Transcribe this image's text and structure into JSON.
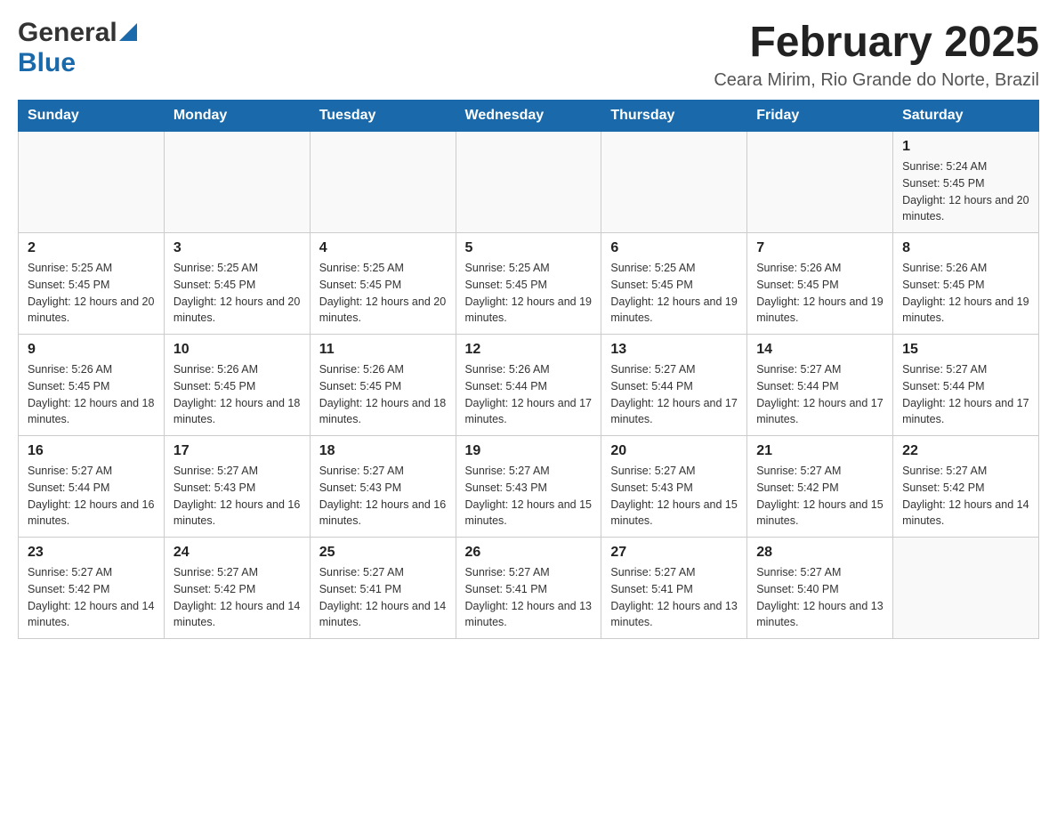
{
  "header": {
    "logo_general": "General",
    "logo_blue": "Blue",
    "title": "February 2025",
    "subtitle": "Ceara Mirim, Rio Grande do Norte, Brazil"
  },
  "days_of_week": [
    "Sunday",
    "Monday",
    "Tuesday",
    "Wednesday",
    "Thursday",
    "Friday",
    "Saturday"
  ],
  "weeks": [
    {
      "days": [
        {
          "number": "",
          "info": ""
        },
        {
          "number": "",
          "info": ""
        },
        {
          "number": "",
          "info": ""
        },
        {
          "number": "",
          "info": ""
        },
        {
          "number": "",
          "info": ""
        },
        {
          "number": "",
          "info": ""
        },
        {
          "number": "1",
          "info": "Sunrise: 5:24 AM\nSunset: 5:45 PM\nDaylight: 12 hours and 20 minutes."
        }
      ]
    },
    {
      "days": [
        {
          "number": "2",
          "info": "Sunrise: 5:25 AM\nSunset: 5:45 PM\nDaylight: 12 hours and 20 minutes."
        },
        {
          "number": "3",
          "info": "Sunrise: 5:25 AM\nSunset: 5:45 PM\nDaylight: 12 hours and 20 minutes."
        },
        {
          "number": "4",
          "info": "Sunrise: 5:25 AM\nSunset: 5:45 PM\nDaylight: 12 hours and 20 minutes."
        },
        {
          "number": "5",
          "info": "Sunrise: 5:25 AM\nSunset: 5:45 PM\nDaylight: 12 hours and 19 minutes."
        },
        {
          "number": "6",
          "info": "Sunrise: 5:25 AM\nSunset: 5:45 PM\nDaylight: 12 hours and 19 minutes."
        },
        {
          "number": "7",
          "info": "Sunrise: 5:26 AM\nSunset: 5:45 PM\nDaylight: 12 hours and 19 minutes."
        },
        {
          "number": "8",
          "info": "Sunrise: 5:26 AM\nSunset: 5:45 PM\nDaylight: 12 hours and 19 minutes."
        }
      ]
    },
    {
      "days": [
        {
          "number": "9",
          "info": "Sunrise: 5:26 AM\nSunset: 5:45 PM\nDaylight: 12 hours and 18 minutes."
        },
        {
          "number": "10",
          "info": "Sunrise: 5:26 AM\nSunset: 5:45 PM\nDaylight: 12 hours and 18 minutes."
        },
        {
          "number": "11",
          "info": "Sunrise: 5:26 AM\nSunset: 5:45 PM\nDaylight: 12 hours and 18 minutes."
        },
        {
          "number": "12",
          "info": "Sunrise: 5:26 AM\nSunset: 5:44 PM\nDaylight: 12 hours and 17 minutes."
        },
        {
          "number": "13",
          "info": "Sunrise: 5:27 AM\nSunset: 5:44 PM\nDaylight: 12 hours and 17 minutes."
        },
        {
          "number": "14",
          "info": "Sunrise: 5:27 AM\nSunset: 5:44 PM\nDaylight: 12 hours and 17 minutes."
        },
        {
          "number": "15",
          "info": "Sunrise: 5:27 AM\nSunset: 5:44 PM\nDaylight: 12 hours and 17 minutes."
        }
      ]
    },
    {
      "days": [
        {
          "number": "16",
          "info": "Sunrise: 5:27 AM\nSunset: 5:44 PM\nDaylight: 12 hours and 16 minutes."
        },
        {
          "number": "17",
          "info": "Sunrise: 5:27 AM\nSunset: 5:43 PM\nDaylight: 12 hours and 16 minutes."
        },
        {
          "number": "18",
          "info": "Sunrise: 5:27 AM\nSunset: 5:43 PM\nDaylight: 12 hours and 16 minutes."
        },
        {
          "number": "19",
          "info": "Sunrise: 5:27 AM\nSunset: 5:43 PM\nDaylight: 12 hours and 15 minutes."
        },
        {
          "number": "20",
          "info": "Sunrise: 5:27 AM\nSunset: 5:43 PM\nDaylight: 12 hours and 15 minutes."
        },
        {
          "number": "21",
          "info": "Sunrise: 5:27 AM\nSunset: 5:42 PM\nDaylight: 12 hours and 15 minutes."
        },
        {
          "number": "22",
          "info": "Sunrise: 5:27 AM\nSunset: 5:42 PM\nDaylight: 12 hours and 14 minutes."
        }
      ]
    },
    {
      "days": [
        {
          "number": "23",
          "info": "Sunrise: 5:27 AM\nSunset: 5:42 PM\nDaylight: 12 hours and 14 minutes."
        },
        {
          "number": "24",
          "info": "Sunrise: 5:27 AM\nSunset: 5:42 PM\nDaylight: 12 hours and 14 minutes."
        },
        {
          "number": "25",
          "info": "Sunrise: 5:27 AM\nSunset: 5:41 PM\nDaylight: 12 hours and 14 minutes."
        },
        {
          "number": "26",
          "info": "Sunrise: 5:27 AM\nSunset: 5:41 PM\nDaylight: 12 hours and 13 minutes."
        },
        {
          "number": "27",
          "info": "Sunrise: 5:27 AM\nSunset: 5:41 PM\nDaylight: 12 hours and 13 minutes."
        },
        {
          "number": "28",
          "info": "Sunrise: 5:27 AM\nSunset: 5:40 PM\nDaylight: 12 hours and 13 minutes."
        },
        {
          "number": "",
          "info": ""
        }
      ]
    }
  ]
}
